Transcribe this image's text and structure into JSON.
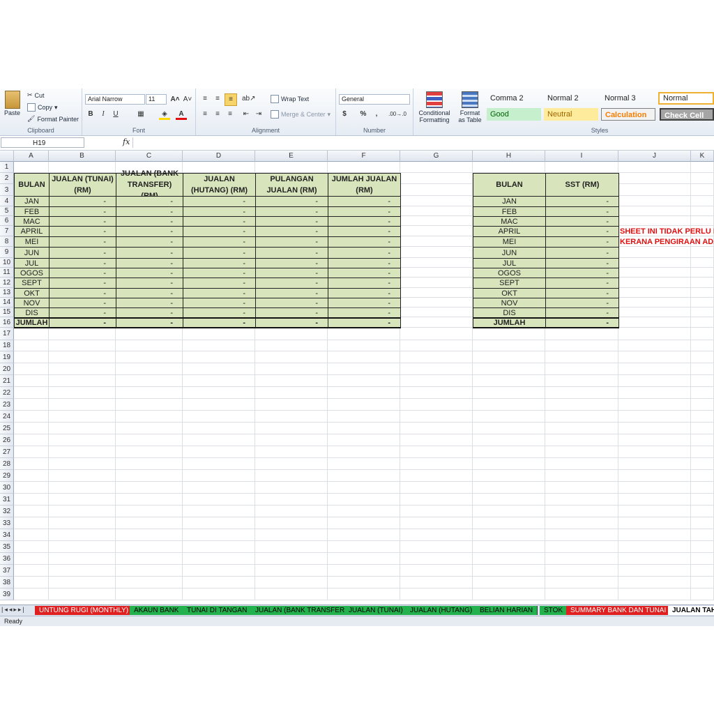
{
  "ribbon": {
    "clipboard": {
      "paste": "Paste",
      "cut": "Cut",
      "copy": "Copy",
      "format_painter": "Format Painter",
      "label": "Clipboard"
    },
    "font": {
      "name": "Arial Narrow",
      "size": "11",
      "bold": "B",
      "italic": "I",
      "underline": "U",
      "label": "Font"
    },
    "alignment": {
      "wrap_text": "Wrap Text",
      "merge_center": "Merge & Center",
      "label": "Alignment"
    },
    "number": {
      "format": "General",
      "currency": "$",
      "percent": "%",
      "comma": ",",
      "inc_dec": ".00→.0",
      "label": "Number"
    },
    "conditional_formatting": "Conditional Formatting",
    "format_as_table": "Format as Table",
    "styles": {
      "comma2": "Comma 2",
      "normal2": "Normal 2",
      "normal3": "Normal 3",
      "normal": "Normal",
      "good": "Good",
      "neutral": "Neutral",
      "calculation": "Calculation",
      "check_cell": "Check Cell",
      "label": "Styles"
    }
  },
  "formula_bar": {
    "name_box": "H19",
    "fx": "fx",
    "value": ""
  },
  "columns": [
    "A",
    "B",
    "C",
    "D",
    "E",
    "F",
    "G",
    "H",
    "I",
    "J",
    "K"
  ],
  "rows": [
    "1",
    "2",
    "3",
    "4",
    "5",
    "6",
    "7",
    "8",
    "9",
    "10",
    "11",
    "12",
    "13",
    "14",
    "15",
    "16",
    "17",
    "18",
    "19",
    "20",
    "21",
    "22",
    "23",
    "24",
    "25",
    "26",
    "27",
    "28",
    "29",
    "30",
    "31",
    "32",
    "33",
    "34",
    "35",
    "36",
    "37",
    "38",
    "39"
  ],
  "table1": {
    "headers": [
      "BULAN",
      "JUALAN  (TUNAI) (RM)",
      "JUALAN (BANK TRANSFER) (RM)",
      "JUALAN (HUTANG) (RM)",
      "PULANGAN JUALAN (RM)",
      "JUMLAH JUALAN (RM)"
    ],
    "months": [
      "JAN",
      "FEB",
      "MAC",
      "APRIL",
      "MEI",
      "JUN",
      "JUL",
      "OGOS",
      "SEPT",
      "OKT",
      "NOV",
      "DIS"
    ],
    "empty_value": "-",
    "total_label": "JUMLAH"
  },
  "table2": {
    "headers": [
      "BULAN",
      "SST (RM)"
    ],
    "months": [
      "JAN",
      "FEB",
      "MAC",
      "APRIL",
      "MEI",
      "JUN",
      "JUL",
      "OGOS",
      "SEPT",
      "OKT",
      "NOV",
      "DIS"
    ],
    "empty_value": "-",
    "total_label": "JUMLAH"
  },
  "notes": {
    "line1": "SHEET INI TIDAK PERLU DI",
    "line2": "KERANA PENGIRAAN ADAL"
  },
  "sheet_tabs": [
    {
      "label": "UNTUNG RUGI (MONTHLY)",
      "color": "#e02020",
      "text": "#ffffff"
    },
    {
      "label": "AKAUN BANK",
      "color": "#22b14c",
      "text": "#000000"
    },
    {
      "label": "TUNAI DI TANGAN",
      "color": "#22b14c",
      "text": "#000000"
    },
    {
      "label": "JUALAN (BANK TRANSFER)",
      "color": "#22b14c",
      "text": "#000000"
    },
    {
      "label": "JUALAN (TUNAI)",
      "color": "#22b14c",
      "text": "#000000"
    },
    {
      "label": "JUALAN (HUTANG)",
      "color": "#22b14c",
      "text": "#000000"
    },
    {
      "label": "BELIAN HARIAN",
      "color": "#22b14c",
      "text": "#000000"
    },
    {
      "label": "STOK",
      "color": "#22b14c",
      "text": "#000000"
    },
    {
      "label": "SUMMARY BANK DAN TUNAI",
      "color": "#e02020",
      "text": "#ffffff"
    },
    {
      "label": "JUALAN TAH",
      "color": "#ffffff",
      "text": "#000000"
    }
  ],
  "status": "Ready",
  "colors": {
    "table_fill": "#d8e4bc",
    "note": "#e01010"
  }
}
